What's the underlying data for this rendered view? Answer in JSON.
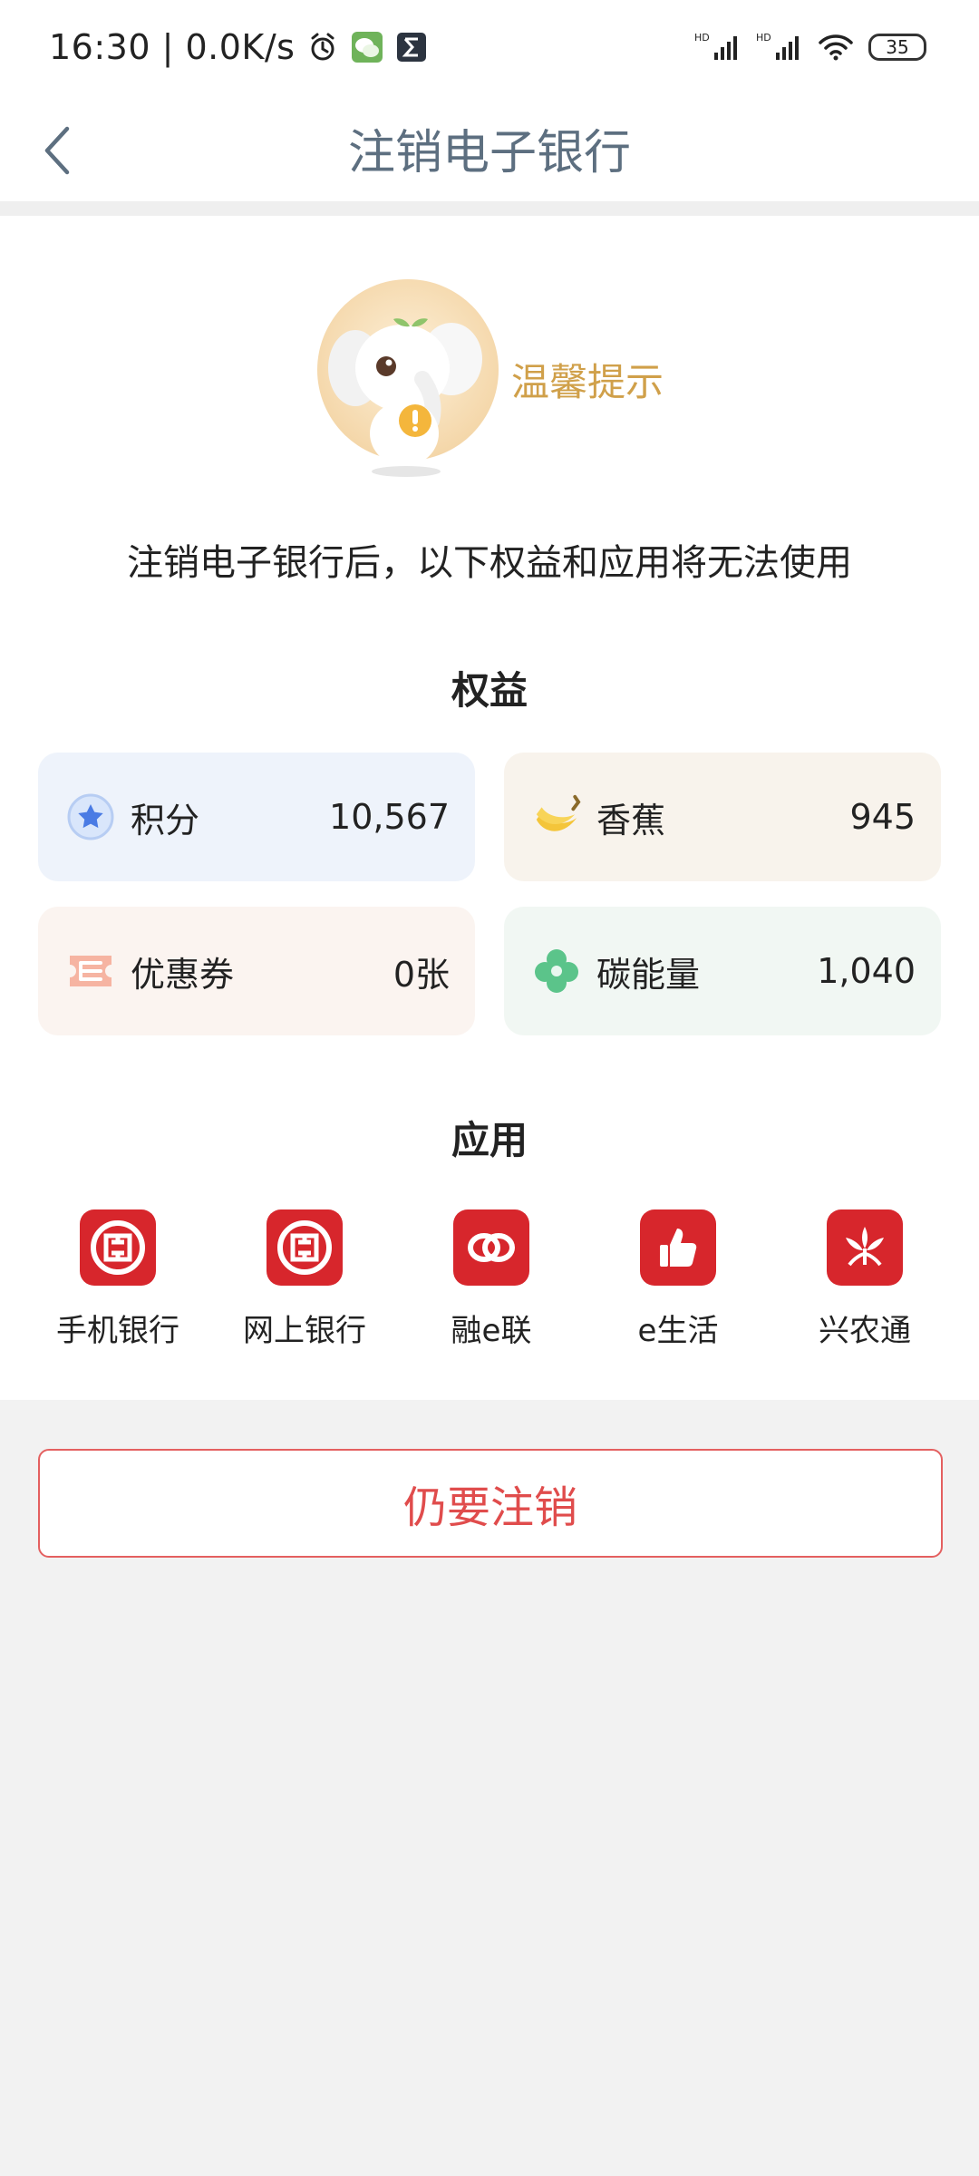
{
  "status_bar": {
    "time_speed": "16:30 | 0.0K/s",
    "battery": "35",
    "icons": [
      "alarm-icon",
      "wechat-icon",
      "sigma-icon",
      "hd-signal-icon",
      "hd-signal-icon",
      "wifi-icon",
      "battery-icon"
    ]
  },
  "header": {
    "back_icon": "chevron-left-icon",
    "title": "注销电子银行"
  },
  "tip": {
    "title": "温馨提示",
    "message": "注销电子银行后，以下权益和应用将无法使用"
  },
  "benefits": {
    "section_title": "权益",
    "items": [
      {
        "label": "积分",
        "value": "10,567",
        "icon": "star-badge-icon"
      },
      {
        "label": "香蕉",
        "value": "945",
        "icon": "banana-icon"
      },
      {
        "label": "优惠券",
        "value": "0张",
        "icon": "coupon-icon"
      },
      {
        "label": "碳能量",
        "value": "1,040",
        "icon": "clover-icon"
      }
    ]
  },
  "apps": {
    "section_title": "应用",
    "items": [
      {
        "label": "手机银行",
        "icon": "icbc-logo-icon"
      },
      {
        "label": "网上银行",
        "icon": "icbc-logo-icon"
      },
      {
        "label": "融e联",
        "icon": "rong-e-lian-icon"
      },
      {
        "label": "e生活",
        "icon": "thumbs-up-icon"
      },
      {
        "label": "兴农通",
        "icon": "xingnongtong-icon"
      }
    ]
  },
  "action": {
    "button_label": "仍要注销"
  },
  "colors": {
    "title_gray": "#5d6f80",
    "tip_gold": "#d0a04a",
    "brand_red": "#d7262c",
    "button_red": "#e04c4c",
    "highlight_yellow": "#f7cd6e"
  }
}
